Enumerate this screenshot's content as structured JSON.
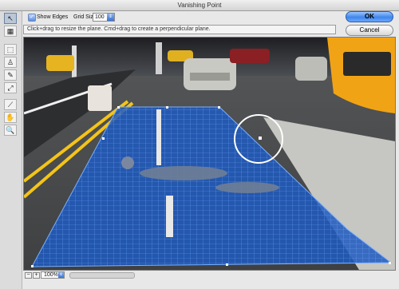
{
  "window": {
    "title": "Vanishing Point"
  },
  "options": {
    "show_edges_label": "Show Edges",
    "show_edges_checked": true,
    "grid_size_label": "Grid Size:",
    "grid_size_value": "100"
  },
  "hint": "Click+drag to resize the plane. Cmd+drag to create a perpendicular plane.",
  "buttons": {
    "ok": "OK",
    "cancel": "Cancel"
  },
  "tools": [
    {
      "name": "edit-plane-tool-icon",
      "glyph": "↖",
      "selected": true
    },
    {
      "name": "create-plane-tool-icon",
      "glyph": "▦",
      "selected": false
    },
    {
      "name": "marquee-tool-icon",
      "glyph": "⬚",
      "selected": false
    },
    {
      "name": "stamp-tool-icon",
      "glyph": "♙",
      "selected": false
    },
    {
      "name": "brush-tool-icon",
      "glyph": "✎",
      "selected": false
    },
    {
      "name": "transform-tool-icon",
      "glyph": "⤢",
      "selected": false
    },
    {
      "name": "eyedropper-tool-icon",
      "glyph": "⟋",
      "selected": false
    },
    {
      "name": "hand-tool-icon",
      "glyph": "✋",
      "selected": false
    },
    {
      "name": "zoom-tool-icon",
      "glyph": "🔍",
      "selected": false
    }
  ],
  "status": {
    "zoom_value": "100%",
    "zoom_out": "−",
    "zoom_in": "+"
  },
  "colors": {
    "accent": "#3f86ea",
    "grid": "#2f6fd6"
  }
}
